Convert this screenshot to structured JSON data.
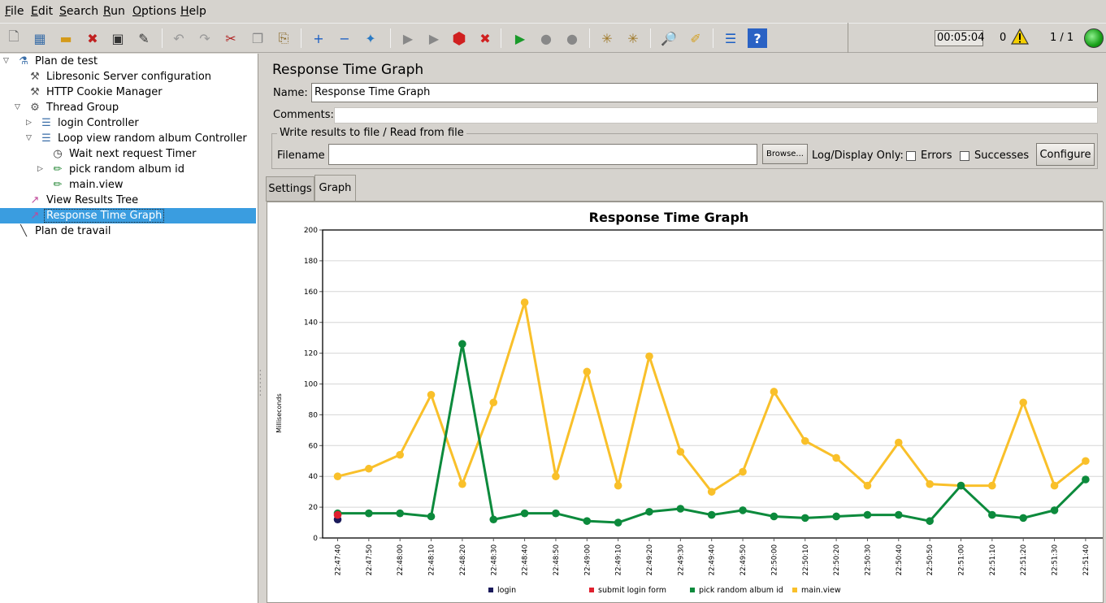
{
  "menu": {
    "items": [
      {
        "label": "File",
        "u": "F",
        "rest": "ile"
      },
      {
        "label": "Edit",
        "u": "E",
        "rest": "dit"
      },
      {
        "label": "Search",
        "u": "S",
        "rest": "earch"
      },
      {
        "label": "Run",
        "u": "R",
        "rest": "un"
      },
      {
        "label": "Options",
        "u": "O",
        "rest": "ptions"
      },
      {
        "label": "Help",
        "u": "H",
        "rest": "elp"
      }
    ]
  },
  "toolbar": {
    "icons": [
      "new-icon",
      "templates-icon",
      "open-icon",
      "close-icon",
      "save-icon",
      "save-as-icon",
      "undo-icon",
      "redo-icon",
      "cut-icon",
      "copy-icon",
      "paste-icon",
      "expand-icon",
      "collapse-icon",
      "toggle-icon",
      "start-icon",
      "start-no-pause-icon",
      "stop-icon",
      "shutdown-icon",
      "remote-start-icon",
      "remote-stop-icon",
      "remote-shutdown-icon",
      "clear-icon",
      "clear-all-icon",
      "search-icon",
      "reset-search-icon",
      "function-helper-icon",
      "help-icon"
    ],
    "timer": "00:05:04",
    "warning_count": "0",
    "threads": "1 / 1"
  },
  "tree": {
    "items": [
      {
        "label": "Plan de test",
        "icon": "test-plan-icon"
      },
      {
        "label": "Libresonic Server configuration",
        "icon": "config-icon"
      },
      {
        "label": "HTTP Cookie Manager",
        "icon": "config-icon"
      },
      {
        "label": "Thread Group",
        "icon": "thread-group-icon"
      },
      {
        "label": "login Controller",
        "icon": "controller-icon"
      },
      {
        "label": "Loop view random album Controller",
        "icon": "controller-icon"
      },
      {
        "label": "Wait next request Timer",
        "icon": "timer-icon"
      },
      {
        "label": "pick random album id",
        "icon": "sampler-icon"
      },
      {
        "label": "main.view",
        "icon": "sampler-icon"
      },
      {
        "label": "View Results Tree",
        "icon": "listener-icon"
      },
      {
        "label": "Response Time Graph",
        "icon": "listener-icon"
      },
      {
        "label": "Plan de travail",
        "icon": "workbench-icon"
      }
    ]
  },
  "panel": {
    "title": "Response Time Graph",
    "name_label": "Name:",
    "name_value": "Response Time Graph",
    "comments_label": "Comments:",
    "file_group_title": "Write results to file / Read from file",
    "filename_label": "Filename",
    "browse_label": "Browse...",
    "logdisplay_label": "Log/Display Only:",
    "errors_label": "Errors",
    "successes_label": "Successes",
    "configure_label": "Configure",
    "tabs": [
      "Settings",
      "Graph"
    ]
  },
  "chart_data": {
    "type": "line",
    "title": "Response Time Graph",
    "xlabel": "",
    "ylabel": "Milliseconds",
    "ylim": [
      0,
      200
    ],
    "yticks": [
      0,
      20,
      40,
      60,
      80,
      100,
      120,
      140,
      160,
      180,
      200
    ],
    "grid": true,
    "legend": "bottom",
    "categories": [
      "22:47:40",
      "22:47:50",
      "22:48:00",
      "22:48:10",
      "22:48:20",
      "22:48:30",
      "22:48:40",
      "22:48:50",
      "22:49:00",
      "22:49:10",
      "22:49:20",
      "22:49:30",
      "22:49:40",
      "22:49:50",
      "22:50:00",
      "22:50:10",
      "22:50:20",
      "22:50:30",
      "22:50:40",
      "22:50:50",
      "22:51:00",
      "22:51:10",
      "22:51:20",
      "22:51:30",
      "22:51:40"
    ],
    "series": [
      {
        "name": "login",
        "color": "#1a1a5a",
        "values": [
          12,
          null,
          null,
          null,
          null,
          null,
          null,
          null,
          null,
          null,
          null,
          null,
          null,
          null,
          null,
          null,
          null,
          null,
          null,
          null,
          null,
          null,
          null,
          null,
          null
        ]
      },
      {
        "name": "submit login form",
        "color": "#e0202e",
        "values": [
          15,
          null,
          null,
          null,
          null,
          null,
          null,
          null,
          null,
          null,
          null,
          null,
          null,
          null,
          null,
          null,
          null,
          null,
          null,
          null,
          null,
          null,
          null,
          null,
          null
        ]
      },
      {
        "name": "pick random album id",
        "color": "#0c8a3c",
        "values": [
          16,
          16,
          16,
          14,
          126,
          12,
          16,
          16,
          11,
          10,
          17,
          19,
          15,
          18,
          14,
          13,
          14,
          15,
          15,
          11,
          34,
          15,
          13,
          18,
          38
        ]
      },
      {
        "name": "main.view",
        "color": "#f9c02a",
        "values": [
          40,
          45,
          54,
          93,
          35,
          88,
          153,
          40,
          108,
          34,
          118,
          56,
          30,
          43,
          95,
          63,
          52,
          34,
          62,
          35,
          34,
          34,
          88,
          34,
          50
        ]
      }
    ]
  }
}
